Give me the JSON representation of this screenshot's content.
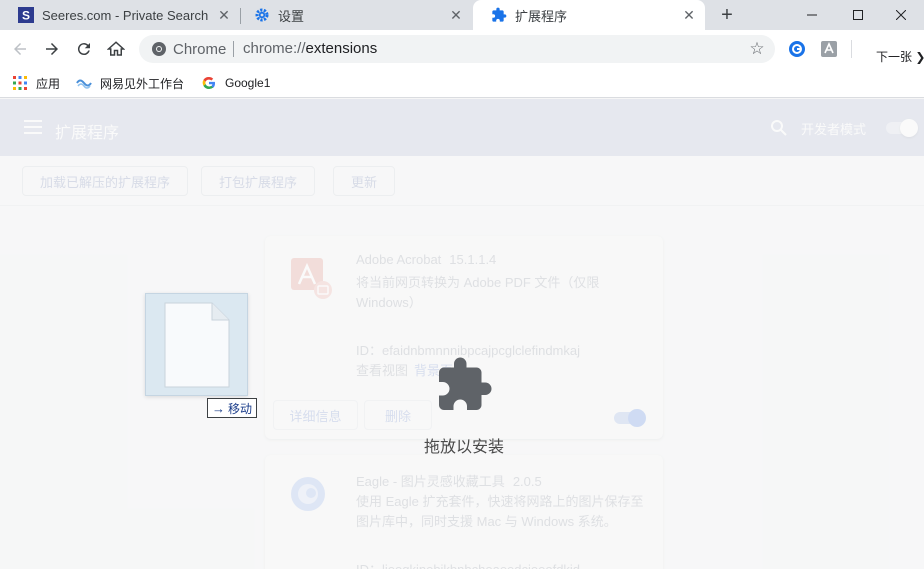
{
  "tabs": [
    {
      "title": "Seeres.com - Private Search",
      "favicon": "s-logo-icon",
      "active": false
    },
    {
      "title": "设置",
      "favicon": "gear-icon",
      "active": false
    },
    {
      "title": "扩展程序",
      "favicon": "puzzle-icon",
      "active": true
    }
  ],
  "window": {
    "minimize": "minimize-icon",
    "maximize": "maximize-icon",
    "close": "close-icon"
  },
  "toolbar": {
    "omnibox_chip": "Chrome",
    "url_scheme": "chrome://",
    "url_path": "extensions",
    "next_page_label": "下一张"
  },
  "bookmarks": [
    {
      "label": "应用",
      "icon": "apps-grid-icon"
    },
    {
      "label": "网易见外工作台",
      "icon": "netease-icon"
    },
    {
      "label": "Google1",
      "icon": "google-icon"
    }
  ],
  "ext_page": {
    "title": "扩展程序",
    "dev_mode_label": "开发者模式",
    "load_unpacked": "加载已解压的扩展程序",
    "pack": "打包扩展程序",
    "update": "更新"
  },
  "extensions": [
    {
      "name": "Adobe Acrobat",
      "version": "15.1.1.4",
      "description": "将当前网页转换为 Adobe PDF 文件（仅限 Windows）",
      "id": "ID：efaidnbmnnnibpcajpcglclefindmkaj",
      "view_label": "查看视图",
      "view_link": "背景页",
      "details_button": "详细信息",
      "remove_button": "删除",
      "enabled": true
    },
    {
      "name": "Eagle - 图片灵感收藏工具",
      "version": "2.0.5",
      "description": "使用 Eagle 扩充套件，快速将网路上的图片保存至图片库中，同时支援 Mac 与 Windows 系统。",
      "id": "ID：lieogkinebjkbnbcheaeedcioeofdkjd"
    }
  ],
  "drag": {
    "move_label": "移动",
    "drop_text": "拖放以安装"
  },
  "colors": {
    "accent": "#1a73e8",
    "header_bg": "#d6dbe8",
    "tabstrip_bg": "#dee1e6"
  }
}
